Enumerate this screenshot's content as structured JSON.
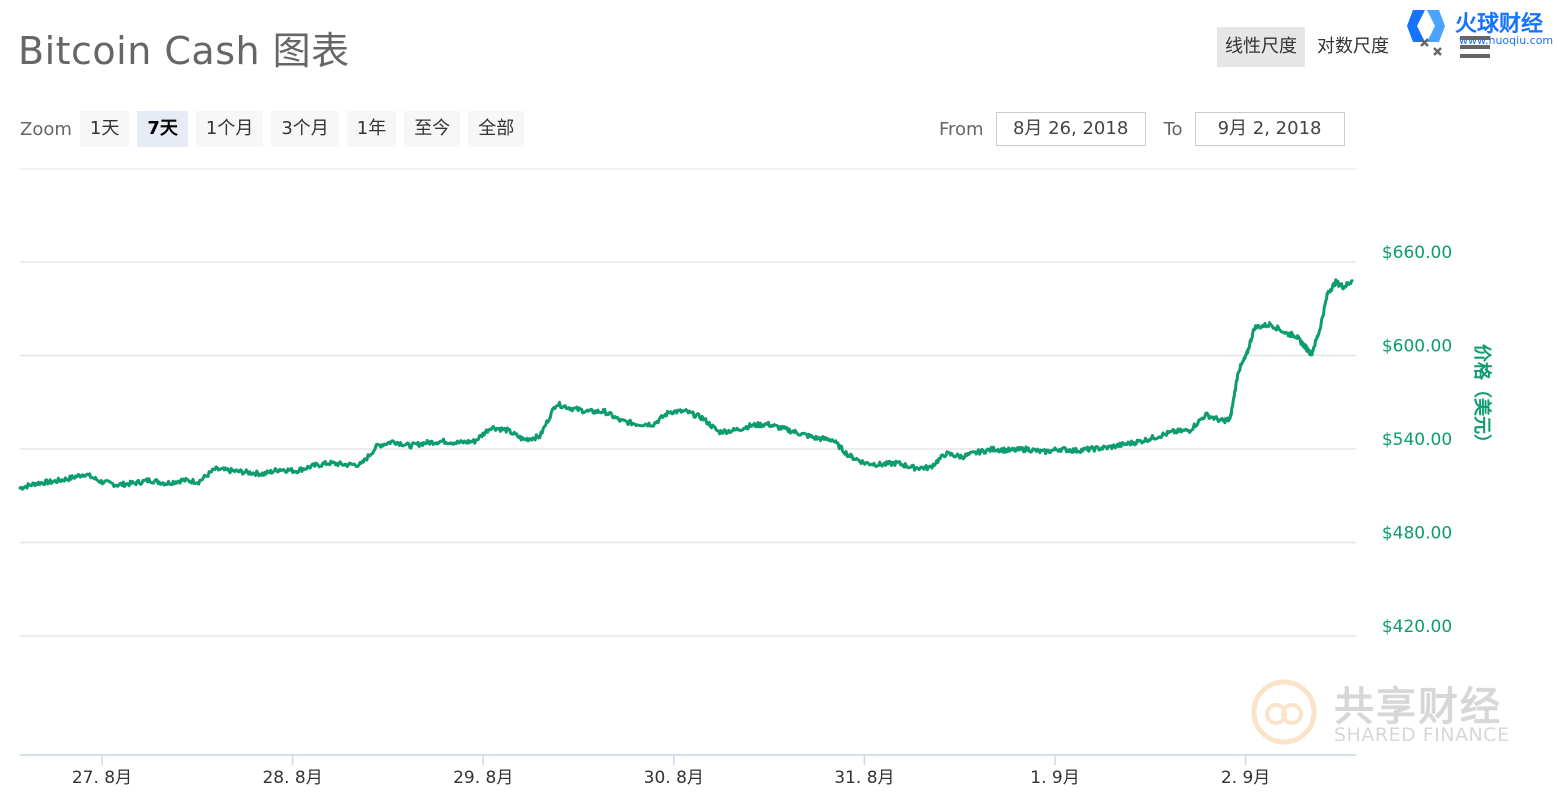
{
  "title": "Bitcoin Cash 图表",
  "scale_buttons": [
    {
      "label": "线性尺度",
      "active": true
    },
    {
      "label": "对数尺度",
      "active": false
    }
  ],
  "logo": {
    "name": "火球财经",
    "url": "www.huoqiu.com"
  },
  "zoom": {
    "label": "Zoom",
    "buttons": [
      {
        "label": "1天",
        "active": false
      },
      {
        "label": "7天",
        "active": true
      },
      {
        "label": "1个月",
        "active": false
      },
      {
        "label": "3个月",
        "active": false
      },
      {
        "label": "1年",
        "active": false
      },
      {
        "label": "至今",
        "active": false
      },
      {
        "label": "全部",
        "active": false
      }
    ]
  },
  "range": {
    "from_label": "From",
    "from_value": "8月 26, 2018",
    "to_label": "To",
    "to_value": "9月 2, 2018"
  },
  "watermark": {
    "cn": "共享财经",
    "en": "SHARED FINANCE"
  },
  "colors": {
    "line": "#0d9c6f",
    "axis_text": "#0d9c6f",
    "grid": "#e6e6e6"
  },
  "chart_data": {
    "type": "line",
    "title": "Bitcoin Cash 图表",
    "ylabel": "价格（美元）",
    "ylim": [
      360,
      720
    ],
    "yticks": [
      420,
      480,
      540,
      600,
      660
    ],
    "ytick_labels": [
      "$420.00",
      "$480.00",
      "$540.00",
      "$600.00",
      "$660.00"
    ],
    "xticks": [
      0.5,
      1.5,
      2.5,
      3.5,
      4.5,
      5.5,
      6.5
    ],
    "xtick_labels": [
      "27. 8月",
      "28. 8月",
      "29. 8月",
      "30. 8月",
      "31. 8月",
      "1. 9月",
      "2. 9月"
    ],
    "xlim": [
      0,
      7.0
    ],
    "grid": true,
    "series": [
      {
        "values": [
          [
            0.0,
            515
          ],
          [
            0.1,
            518
          ],
          [
            0.2,
            519
          ],
          [
            0.3,
            521
          ],
          [
            0.4,
            524
          ],
          [
            0.5,
            519
          ],
          [
            0.6,
            517
          ],
          [
            0.7,
            518
          ],
          [
            0.8,
            520
          ],
          [
            0.9,
            518
          ],
          [
            1.0,
            520
          ],
          [
            1.1,
            519
          ],
          [
            1.2,
            527
          ],
          [
            1.3,
            526
          ],
          [
            1.4,
            525
          ],
          [
            1.5,
            524
          ],
          [
            1.6,
            527
          ],
          [
            1.7,
            526
          ],
          [
            1.8,
            529
          ],
          [
            1.9,
            531
          ],
          [
            2.0,
            530
          ],
          [
            2.1,
            530
          ],
          [
            2.2,
            542
          ],
          [
            2.3,
            545
          ],
          [
            2.4,
            542
          ],
          [
            2.5,
            544
          ],
          [
            2.6,
            545
          ],
          [
            2.7,
            544
          ],
          [
            2.8,
            545
          ],
          [
            2.9,
            554
          ],
          [
            3.0,
            552
          ],
          [
            3.1,
            546
          ],
          [
            3.2,
            548
          ],
          [
            3.3,
            569
          ],
          [
            3.4,
            566
          ],
          [
            3.5,
            564
          ],
          [
            3.6,
            564
          ],
          [
            3.7,
            558
          ],
          [
            3.8,
            556
          ],
          [
            3.9,
            556
          ],
          [
            4.0,
            564
          ],
          [
            4.1,
            564
          ],
          [
            4.2,
            560
          ],
          [
            4.3,
            551
          ],
          [
            4.4,
            552
          ],
          [
            4.5,
            555
          ],
          [
            4.6,
            556
          ],
          [
            4.7,
            553
          ],
          [
            4.8,
            550
          ],
          [
            4.9,
            547
          ],
          [
            5.0,
            546
          ],
          [
            5.1,
            536
          ],
          [
            5.2,
            531
          ],
          [
            5.3,
            530
          ],
          [
            5.4,
            531
          ],
          [
            5.5,
            528
          ],
          [
            5.6,
            528
          ],
          [
            5.7,
            537
          ],
          [
            5.8,
            535
          ],
          [
            5.9,
            538
          ],
          [
            6.0,
            540
          ],
          [
            6.1,
            539
          ],
          [
            6.2,
            540
          ],
          [
            6.3,
            538
          ],
          [
            6.4,
            540
          ],
          [
            6.5,
            539
          ],
          [
            6.6,
            540
          ],
          [
            6.7,
            541
          ],
          [
            6.8,
            543
          ],
          [
            6.9,
            545
          ],
          [
            7.0,
            548
          ],
          [
            7.1,
            551
          ],
          [
            7.2,
            552
          ],
          [
            7.3,
            562
          ],
          [
            7.4,
            558
          ],
          [
            7.45,
            559
          ],
          [
            7.5,
            590
          ],
          [
            7.55,
            600
          ],
          [
            7.6,
            618
          ],
          [
            7.7,
            620
          ],
          [
            7.8,
            614
          ],
          [
            7.85,
            613
          ],
          [
            7.9,
            607
          ],
          [
            7.95,
            601
          ],
          [
            8.0,
            616
          ],
          [
            8.05,
            640
          ],
          [
            8.1,
            647
          ],
          [
            8.15,
            644
          ],
          [
            8.2,
            648
          ]
        ]
      }
    ]
  }
}
